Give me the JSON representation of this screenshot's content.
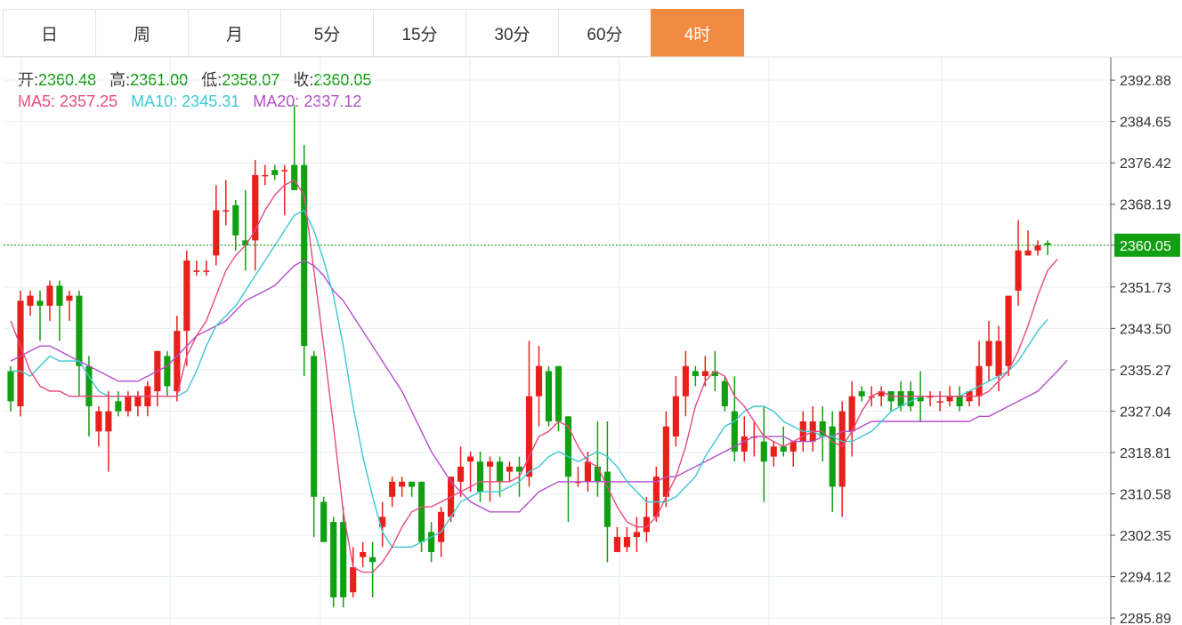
{
  "tabs": [
    {
      "label": "日",
      "active": false
    },
    {
      "label": "周",
      "active": false
    },
    {
      "label": "月",
      "active": false
    },
    {
      "label": "5分",
      "active": false
    },
    {
      "label": "15分",
      "active": false
    },
    {
      "label": "30分",
      "active": false
    },
    {
      "label": "60分",
      "active": false
    },
    {
      "label": "4时",
      "active": true
    }
  ],
  "ohlc_info": {
    "open_label": "开:",
    "open": "2360.48",
    "high_label": "高:",
    "high": "2361.00",
    "low_label": "低:",
    "low": "2358.07",
    "close_label": "收:",
    "close": "2360.05"
  },
  "ma_info": {
    "ma5_label": "MA5:",
    "ma5": "2357.25",
    "ma10_label": "MA10:",
    "ma10": "2345.31",
    "ma20_label": "MA20:",
    "ma20": "2337.12"
  },
  "colors": {
    "up": "#e8201c",
    "down": "#11a011",
    "ma5": "#e84a80",
    "ma10": "#3cc8d4",
    "ma20": "#b450c8",
    "current_price_bg": "#11a011",
    "active_tab": "#f28b42"
  },
  "chart_data": {
    "type": "candlestick",
    "y_ticks": [
      "2392.88",
      "2384.65",
      "2376.42",
      "2368.19",
      "2360.05",
      "2351.73",
      "2343.50",
      "2335.27",
      "2327.04",
      "2318.81",
      "2310.58",
      "2302.35",
      "2294.12",
      "2285.89"
    ],
    "ylim": [
      2284.5,
      2397.5
    ],
    "current_price": 2360.05,
    "current_price_label": "2360.05",
    "grid": true,
    "candles": [
      [
        2335,
        2336,
        2327,
        2329
      ],
      [
        2328,
        2351,
        2326,
        2349
      ],
      [
        2348,
        2351,
        2346,
        2350
      ],
      [
        2349,
        2351,
        2341,
        2348
      ],
      [
        2348,
        2353,
        2345,
        2352
      ],
      [
        2352,
        2353,
        2341,
        2348
      ],
      [
        2349,
        2351,
        2345,
        2350
      ],
      [
        2350,
        2351,
        2330,
        2336
      ],
      [
        2336,
        2338,
        2322,
        2328
      ],
      [
        2323,
        2328,
        2320,
        2327
      ],
      [
        2323,
        2331,
        2315,
        2327
      ],
      [
        2329,
        2331,
        2326,
        2327
      ],
      [
        2327,
        2331,
        2326,
        2330
      ],
      [
        2328,
        2331,
        2326,
        2330
      ],
      [
        2328,
        2333,
        2326,
        2332
      ],
      [
        2331,
        2338,
        2328,
        2339
      ],
      [
        2338,
        2339,
        2330,
        2332
      ],
      [
        2331,
        2346,
        2329,
        2343
      ],
      [
        2343,
        2359,
        2336,
        2357
      ],
      [
        2355,
        2357,
        2354,
        2355
      ],
      [
        2355,
        2357,
        2354,
        2355
      ],
      [
        2358,
        2372,
        2356,
        2367
      ],
      [
        2367,
        2373,
        2364,
        2367
      ],
      [
        2368,
        2369,
        2359,
        2362
      ],
      [
        2361,
        2371,
        2355,
        2360
      ],
      [
        2361,
        2377,
        2355,
        2374
      ],
      [
        2374,
        2376,
        2372,
        2374
      ],
      [
        2375,
        2376,
        2373,
        2374
      ],
      [
        2375,
        2376,
        2366,
        2375
      ],
      [
        2376,
        2388,
        2371,
        2371
      ],
      [
        2376,
        2380,
        2334,
        2340
      ],
      [
        2338,
        2339,
        2302,
        2310
      ],
      [
        2309,
        2310,
        2302,
        2301
      ],
      [
        2305,
        2306,
        2288,
        2290
      ],
      [
        2305,
        2308,
        2288,
        2290
      ],
      [
        2291,
        2300,
        2290,
        2296
      ],
      [
        2298,
        2301,
        2296,
        2299
      ],
      [
        2298,
        2301,
        2290,
        2297
      ],
      [
        2304,
        2309,
        2300,
        2306
      ],
      [
        2310,
        2314,
        2308,
        2313
      ],
      [
        2312,
        2314,
        2310,
        2313
      ],
      [
        2313,
        2313,
        2310,
        2312
      ],
      [
        2313,
        2313,
        2299,
        2301
      ],
      [
        2303,
        2305,
        2297,
        2299
      ],
      [
        2301,
        2308,
        2298,
        2307
      ],
      [
        2306,
        2314,
        2305,
        2314
      ],
      [
        2313,
        2320,
        2310,
        2316
      ],
      [
        2317,
        2319,
        2311,
        2318
      ],
      [
        2317,
        2319,
        2309,
        2311
      ],
      [
        2316,
        2318,
        2309,
        2317
      ],
      [
        2317,
        2318,
        2310,
        2313
      ],
      [
        2315,
        2317,
        2313,
        2316
      ],
      [
        2316,
        2318,
        2310,
        2315
      ],
      [
        2314,
        2341,
        2312,
        2330
      ],
      [
        2330,
        2340,
        2324,
        2336
      ],
      [
        2335,
        2336,
        2324,
        2325
      ],
      [
        2336,
        2336,
        2323,
        2325
      ],
      [
        2326,
        2326,
        2305,
        2314
      ],
      [
        2313,
        2316,
        2312,
        2313
      ],
      [
        2313,
        2319,
        2311,
        2317
      ],
      [
        2316,
        2325,
        2310,
        2313
      ],
      [
        2315,
        2325,
        2297,
        2304
      ],
      [
        2299,
        2304,
        2299,
        2302
      ],
      [
        2300,
        2304,
        2299,
        2302
      ],
      [
        2302,
        2306,
        2299,
        2303
      ],
      [
        2303,
        2310,
        2301,
        2306
      ],
      [
        2306,
        2316,
        2305,
        2314
      ],
      [
        2310,
        2327,
        2308,
        2324
      ],
      [
        2322,
        2334,
        2320,
        2330
      ],
      [
        2330,
        2339,
        2326,
        2336
      ],
      [
        2335,
        2336,
        2332,
        2334
      ],
      [
        2334,
        2338,
        2332,
        2335
      ],
      [
        2335,
        2339,
        2331,
        2334
      ],
      [
        2333,
        2334,
        2327,
        2328
      ],
      [
        2327,
        2334,
        2317,
        2319
      ],
      [
        2319,
        2326,
        2317,
        2322
      ],
      [
        2322,
        2325,
        2318,
        2322
      ],
      [
        2321,
        2328,
        2309,
        2317
      ],
      [
        2318,
        2321,
        2316,
        2320
      ],
      [
        2320,
        2324,
        2318,
        2319
      ],
      [
        2319,
        2321,
        2316,
        2321
      ],
      [
        2321,
        2327,
        2319,
        2325
      ],
      [
        2321,
        2328,
        2319,
        2325
      ],
      [
        2325,
        2328,
        2317,
        2322
      ],
      [
        2324,
        2327,
        2307,
        2312
      ],
      [
        2312,
        2329,
        2306,
        2327
      ],
      [
        2323,
        2333,
        2318,
        2330
      ],
      [
        2331,
        2332,
        2329,
        2330
      ],
      [
        2330,
        2332,
        2328,
        2330
      ],
      [
        2330,
        2332,
        2328,
        2331
      ],
      [
        2331,
        2331,
        2327,
        2329
      ],
      [
        2331,
        2333,
        2327,
        2328
      ],
      [
        2331,
        2333,
        2327,
        2328
      ],
      [
        2330,
        2335,
        2325,
        2329
      ],
      [
        2330,
        2331,
        2328,
        2330
      ],
      [
        2329,
        2331,
        2327,
        2329
      ],
      [
        2329,
        2332,
        2328,
        2330
      ],
      [
        2330,
        2332,
        2327,
        2328
      ],
      [
        2329,
        2331,
        2328,
        2331
      ],
      [
        2330,
        2341,
        2328,
        2336
      ],
      [
        2336,
        2345,
        2333,
        2341
      ],
      [
        2334,
        2344,
        2331,
        2341
      ],
      [
        2336,
        2350,
        2334,
        2350
      ],
      [
        2351,
        2365,
        2348,
        2359
      ],
      [
        2358,
        2363,
        2358,
        2359
      ],
      [
        2359,
        2361,
        2358,
        2360
      ],
      [
        2360.48,
        2361.0,
        2358.07,
        2360.05
      ]
    ],
    "ma5": [
      2345,
      2340,
      2335,
      2332,
      2331,
      2331,
      2330,
      2330,
      2330,
      2330,
      2330,
      2330,
      2330,
      2330,
      2330,
      2330,
      2330,
      2330,
      2338,
      2342,
      2345,
      2350,
      2355,
      2358,
      2360,
      2363,
      2367,
      2370,
      2372,
      2373,
      2370,
      2355,
      2340,
      2324,
      2307,
      2296,
      2295,
      2295,
      2297,
      2300,
      2304,
      2307,
      2308,
      2308,
      2309,
      2310,
      2311,
      2312,
      2313,
      2313,
      2313,
      2313,
      2314,
      2318,
      2322,
      2323,
      2325,
      2324,
      2320,
      2317,
      2316,
      2312,
      2308,
      2305,
      2304,
      2304,
      2306,
      2310,
      2314,
      2320,
      2328,
      2333,
      2335,
      2334,
      2330,
      2328,
      2325,
      2322,
      2321,
      2320,
      2321,
      2322,
      2323,
      2323,
      2321,
      2320,
      2323,
      2327,
      2330,
      2331,
      2330,
      2330,
      2330,
      2330,
      2330,
      2330,
      2330,
      2330,
      2330,
      2330,
      2331,
      2333,
      2335,
      2339,
      2344,
      2350,
      2355,
      2357.25
    ],
    "ma10": [
      2335,
      2335,
      2334,
      2336,
      2338,
      2337,
      2337,
      2337,
      2334,
      2331,
      2330,
      2330,
      2330,
      2330,
      2330,
      2330,
      2330,
      2330,
      2331,
      2335,
      2340,
      2344,
      2346,
      2348,
      2351,
      2354,
      2357,
      2360,
      2363,
      2366,
      2367,
      2363,
      2357,
      2350,
      2340,
      2328,
      2318,
      2310,
      2303,
      2300,
      2300,
      2300,
      2301,
      2302,
      2303,
      2306,
      2309,
      2310,
      2311,
      2311,
      2311,
      2312,
      2313,
      2315,
      2316,
      2318,
      2319,
      2318,
      2317,
      2318,
      2319,
      2318,
      2316,
      2313,
      2311,
      2309,
      2309,
      2309,
      2310,
      2312,
      2314,
      2318,
      2321,
      2324,
      2325,
      2327,
      2328,
      2328,
      2327,
      2325,
      2324,
      2323,
      2323,
      2322,
      2322,
      2321,
      2321,
      2322,
      2323,
      2325,
      2327,
      2328,
      2329,
      2330,
      2330,
      2330,
      2330,
      2330,
      2331,
      2332,
      2333,
      2334,
      2335,
      2337,
      2340,
      2343,
      2345.31
    ],
    "ma20": [
      2337,
      2338,
      2339,
      2340,
      2340,
      2339,
      2338,
      2337,
      2336,
      2335,
      2334,
      2333,
      2333,
      2333,
      2334,
      2335,
      2336,
      2338,
      2340,
      2342,
      2343,
      2344,
      2345,
      2347,
      2349,
      2350,
      2351,
      2352,
      2354,
      2356,
      2357,
      2356,
      2354,
      2351,
      2349,
      2346,
      2343,
      2340,
      2337,
      2334,
      2331,
      2327,
      2323,
      2319,
      2316,
      2313,
      2311,
      2309,
      2308,
      2307,
      2307,
      2307,
      2307,
      2309,
      2311,
      2312,
      2313,
      2313,
      2313,
      2313,
      2313,
      2313,
      2313,
      2313,
      2313,
      2313,
      2313,
      2314,
      2314,
      2315,
      2316,
      2317,
      2318,
      2319,
      2320,
      2321,
      2322,
      2322,
      2322,
      2322,
      2321,
      2321,
      2321,
      2322,
      2322,
      2323,
      2323,
      2324,
      2325,
      2325,
      2325,
      2325,
      2325,
      2325,
      2325,
      2325,
      2325,
      2325,
      2325,
      2326,
      2326,
      2327,
      2328,
      2329,
      2330,
      2331,
      2333,
      2335,
      2337.12
    ]
  }
}
